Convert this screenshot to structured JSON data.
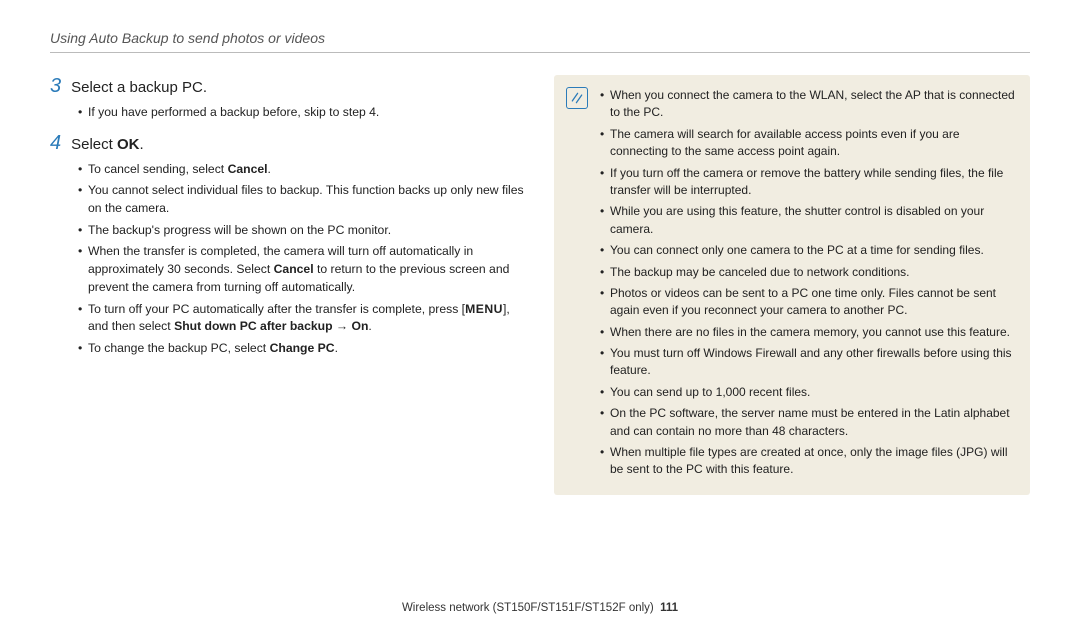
{
  "header": {
    "title": "Using Auto Backup to send photos or videos"
  },
  "steps": {
    "s3": {
      "num": "3",
      "title": "Select a backup PC.",
      "b1": "If you have performed a backup before, skip to step 4."
    },
    "s4": {
      "num": "4",
      "title_pre": "Select ",
      "title_bold": "OK",
      "title_post": ".",
      "b1_pre": "To cancel sending, select ",
      "b1_bold": "Cancel",
      "b1_post": ".",
      "b2": "You cannot select individual files to backup. This function backs up only new files on the camera.",
      "b3": "The backup's progress will be shown on the PC monitor.",
      "b4_pre": "When the transfer is completed, the camera will turn off automatically in approximately 30 seconds. Select ",
      "b4_bold": "Cancel",
      "b4_post": " to return to the previous screen and prevent the camera from turning off automatically.",
      "b5_pre": "To turn off your PC automatically after the transfer is complete, press [",
      "b5_menu": "MENU",
      "b5_mid": "], and then select ",
      "b5_bold": "Shut down PC after backup → On",
      "b5_post": ".",
      "b6_pre": "To change the backup PC, select ",
      "b6_bold": "Change PC",
      "b6_post": "."
    }
  },
  "notes": {
    "n1": "When you connect the camera to the WLAN, select the AP that is connected to the PC.",
    "n2": "The camera will search for available access points even if you are connecting to the same access point again.",
    "n3": "If you turn off the camera or remove the battery while sending files, the file transfer will be interrupted.",
    "n4": "While you are using this feature, the shutter control is disabled on your camera.",
    "n5": "You can connect only one camera to the PC at a time for sending files.",
    "n6": "The backup may be canceled due to network conditions.",
    "n7": "Photos or videos can be sent to a PC one time only. Files cannot be sent again even if you reconnect your camera to another PC.",
    "n8": "When there are no files in the camera memory, you cannot use this feature.",
    "n9": "You must turn off Windows Firewall and any other firewalls before using this feature.",
    "n10": "You can send up to 1,000 recent files.",
    "n11": "On the PC software, the server name must be entered in the Latin alphabet and can contain no more than 48 characters.",
    "n12": "When multiple file types are created at once, only the image files (JPG) will be sent to the PC with this feature."
  },
  "footer": {
    "text": "Wireless network  (ST150F/ST151F/ST152F only)",
    "page": "111"
  }
}
